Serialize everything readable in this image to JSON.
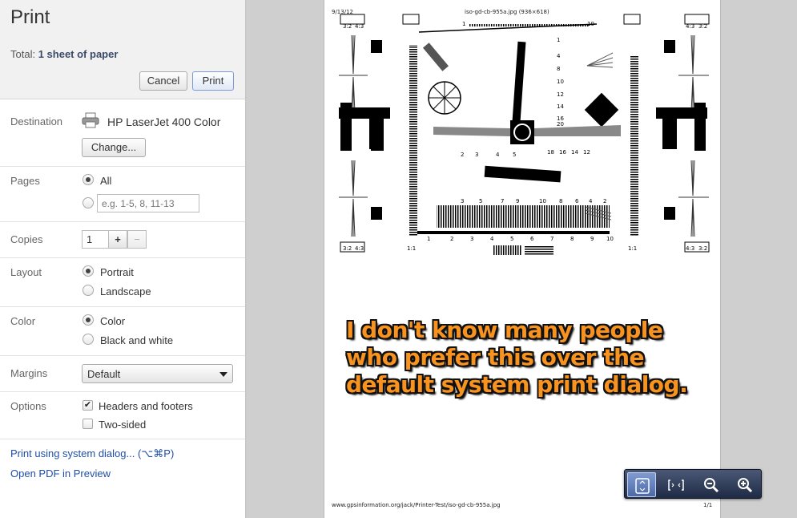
{
  "header": {
    "title": "Print",
    "summary_label": "Total:",
    "summary_value": "1 sheet of paper",
    "cancel_label": "Cancel",
    "print_label": "Print"
  },
  "destination": {
    "label": "Destination",
    "printer_name": "HP LaserJet 400 Color",
    "change_label": "Change..."
  },
  "pages": {
    "label": "Pages",
    "all_label": "All",
    "custom_placeholder": "e.g. 1-5, 8, 11-13",
    "selected": "All"
  },
  "copies": {
    "label": "Copies",
    "value": "1",
    "plus": "+",
    "minus": "−"
  },
  "layout": {
    "label": "Layout",
    "options": [
      "Portrait",
      "Landscape"
    ],
    "selected": "Portrait"
  },
  "color": {
    "label": "Color",
    "options": [
      "Color",
      "Black and white"
    ],
    "selected": "Color"
  },
  "margins": {
    "label": "Margins",
    "value": "Default"
  },
  "options": {
    "label": "Options",
    "headers_footers": "Headers and footers",
    "headers_footers_checked": true,
    "two_sided": "Two-sided",
    "two_sided_checked": false
  },
  "links": {
    "system_dialog": "Print using system dialog... (⌥⌘P)",
    "open_pdf": "Open PDF in Preview"
  },
  "preview": {
    "date": "9/13/12",
    "doc_title": "iso-gd-cb-955a.jpg (936×618)",
    "footer_url": "www.gpsinformation.org/jack/Printer-Test/iso-gd-cb-955a.jpg",
    "page_count": "1/1",
    "callout_lines": [
      "I don't know many people",
      "who prefer this over the",
      "default system print dialog."
    ]
  },
  "zoom_toolbar": {
    "icons": [
      "fit-to-page-icon",
      "fit-width-icon",
      "zoom-out-icon",
      "zoom-in-icon"
    ]
  }
}
